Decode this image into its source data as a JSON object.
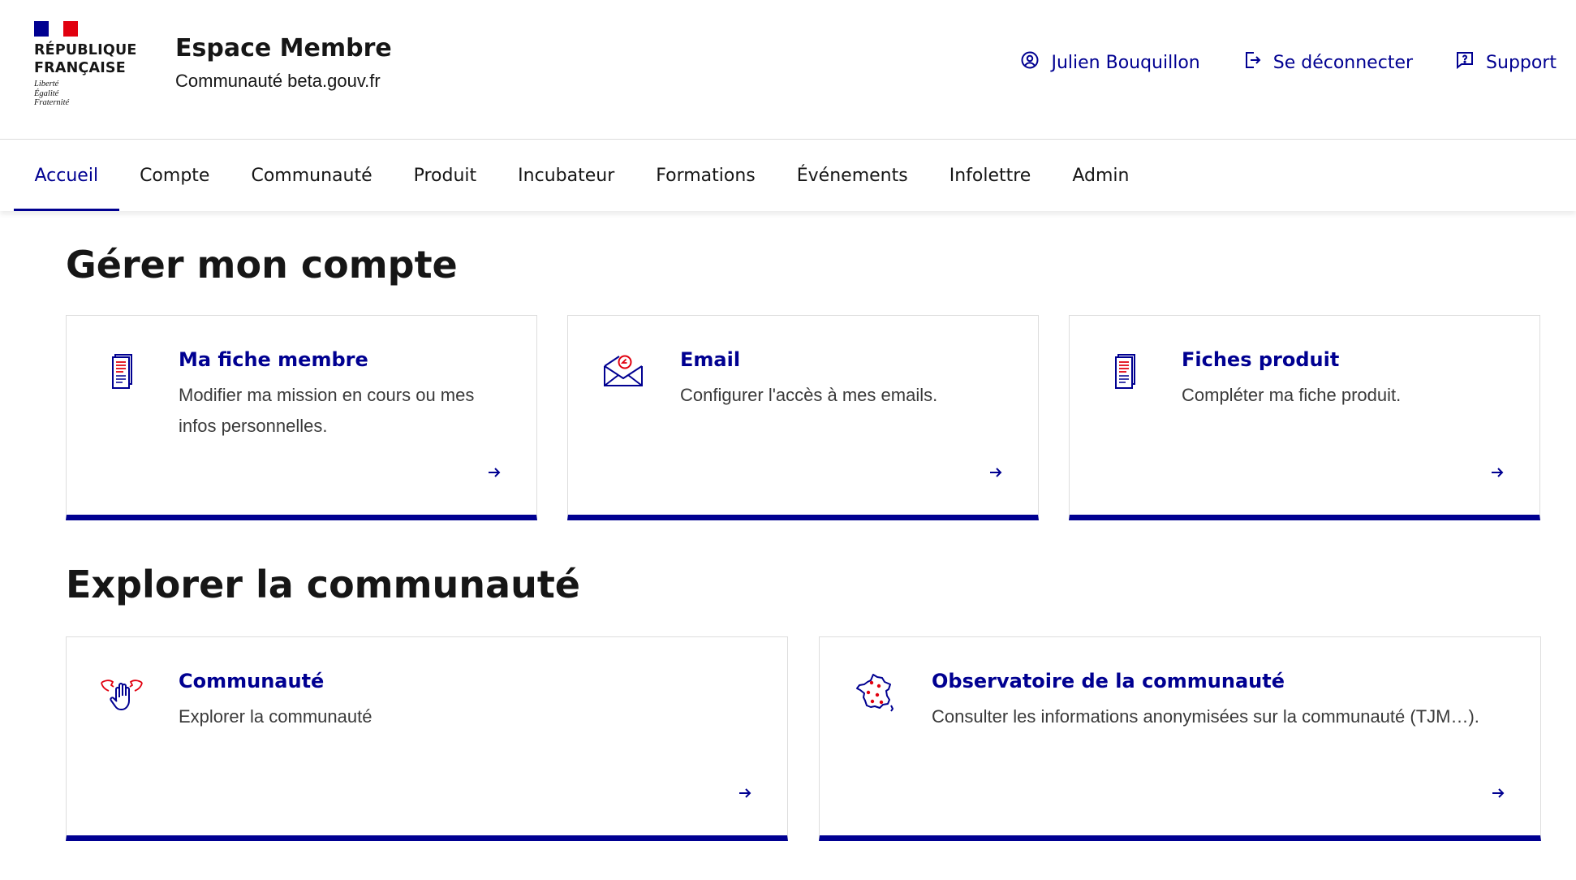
{
  "colors": {
    "primary": "#000091",
    "flag_blue": "#000091",
    "flag_red": "#e1000f",
    "text": "#161616",
    "text_secondary": "#3a3a3a",
    "border": "#dddddd"
  },
  "header": {
    "logo": {
      "title_line1": "RÉPUBLIQUE",
      "title_line2": "FRANÇAISE",
      "motto_line1": "Liberté",
      "motto_line2": "Égalité",
      "motto_line3": "Fraternité"
    },
    "service_title": "Espace Membre",
    "service_tagline": "Communauté beta.gouv.fr",
    "tools": [
      {
        "label": "Julien Bouquillon",
        "icon": "user-icon"
      },
      {
        "label": "Se déconnecter",
        "icon": "logout-icon"
      },
      {
        "label": "Support",
        "icon": "question-icon"
      }
    ]
  },
  "nav": {
    "active": "Accueil",
    "items": [
      {
        "label": "Accueil"
      },
      {
        "label": "Compte"
      },
      {
        "label": "Communauté"
      },
      {
        "label": "Produit"
      },
      {
        "label": "Incubateur"
      },
      {
        "label": "Formations"
      },
      {
        "label": "Événements"
      },
      {
        "label": "Infolettre"
      },
      {
        "label": "Admin"
      }
    ]
  },
  "sections": {
    "account": {
      "title": "Gérer mon compte",
      "tiles": [
        {
          "title": "Ma fiche membre",
          "description": "Modifier ma mission en cours ou mes infos personnelles.",
          "icon": "document-icon"
        },
        {
          "title": "Email",
          "description": "Configurer l'accès à mes emails.",
          "icon": "mail-icon"
        },
        {
          "title": "Fiches produit",
          "description": "Compléter ma fiche produit.",
          "icon": "document-icon"
        }
      ]
    },
    "community": {
      "title": "Explorer la communauté",
      "tiles": [
        {
          "title": "Communauté",
          "description": "Explorer la communauté",
          "icon": "community-hands-icon"
        },
        {
          "title": "Observatoire de la communauté",
          "description": "Consulter les informations anonymisées sur la communauté (TJM…).",
          "icon": "france-map-icon"
        }
      ]
    }
  }
}
